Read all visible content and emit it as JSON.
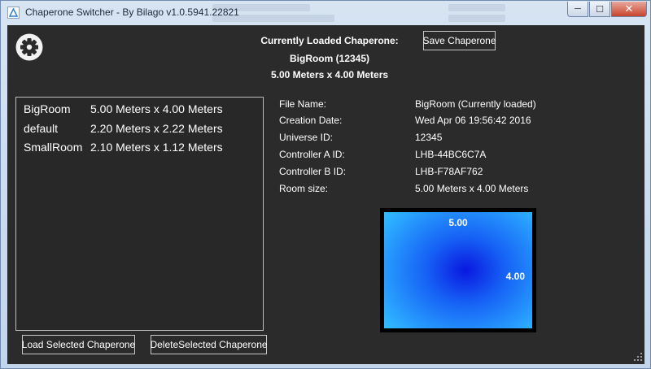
{
  "window": {
    "title": "Chaperone Switcher - By Bilago v1.0.5941.22821",
    "minimize_label": "─",
    "maximize_label": "☐",
    "close_label": "✕"
  },
  "header": {
    "loaded_title": "Currently Loaded Chaperone:",
    "loaded_name": "BigRoom (12345)",
    "loaded_size": "5.00 Meters x 4.00 Meters",
    "save_label": "Save Chaperone"
  },
  "chaperones": [
    {
      "name": "BigRoom",
      "size": "5.00 Meters x 4.00 Meters"
    },
    {
      "name": "default",
      "size": "2.20 Meters x 2.22 Meters"
    },
    {
      "name": "SmallRoom",
      "size": "2.10 Meters x 1.12 Meters"
    }
  ],
  "details": [
    {
      "label": "File Name:",
      "value": "BigRoom (Currently loaded)"
    },
    {
      "label": "Creation Date:",
      "value": "Wed Apr 06 19:56:42 2016"
    },
    {
      "label": "Universe ID:",
      "value": "12345"
    },
    {
      "label": "Controller A ID:",
      "value": "LHB-44BC6C7A"
    },
    {
      "label": "Controller B ID:",
      "value": "LHB-F78AF762"
    },
    {
      "label": "Room size:",
      "value": "5.00 Meters x 4.00 Meters"
    }
  ],
  "room_preview": {
    "width_label": "5.00",
    "height_label": "4.00"
  },
  "buttons": {
    "load_label": "Load Selected Chaperone",
    "delete_label": "DeleteSelected Chaperone"
  },
  "icons": {
    "settings": "gear-icon",
    "app": "steamvr-triangle-icon",
    "resize": "resize-grip-icon"
  },
  "colors": {
    "client_bg": "#2b2b2b",
    "room_center": "#0a18e0",
    "room_edge": "#35c2ff",
    "close_red": "#c7432d"
  }
}
